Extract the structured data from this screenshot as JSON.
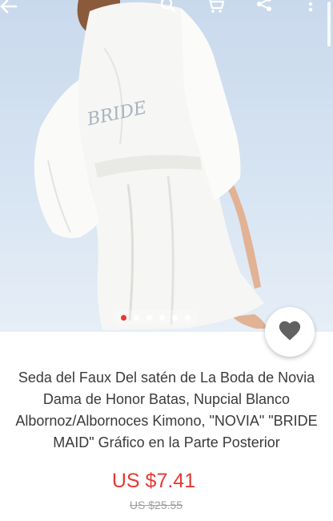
{
  "toolbar": {
    "icons": [
      "back-arrow-icon",
      "search-icon",
      "cart-icon",
      "share-icon",
      "more-vert-icon"
    ]
  },
  "gallery": {
    "image": "white satin bride robe, back view",
    "slide_count": 6,
    "active_index": 0
  },
  "product": {
    "title": "Seda del Faux Del satén de La Boda de Novia Dama de Honor Batas, Nupcial Blanco Albornoz/Albornoces Kimono, \"NOVIA\" \"BRIDE MAID\" Gráfico en la Parte Posterior",
    "robe_print": "BRIDE",
    "price": "US $7.41",
    "original_price": "US $25.55"
  },
  "colors": {
    "price": "#e53935",
    "active_dot": "#e53935",
    "cart_badge": "#f39c12"
  }
}
